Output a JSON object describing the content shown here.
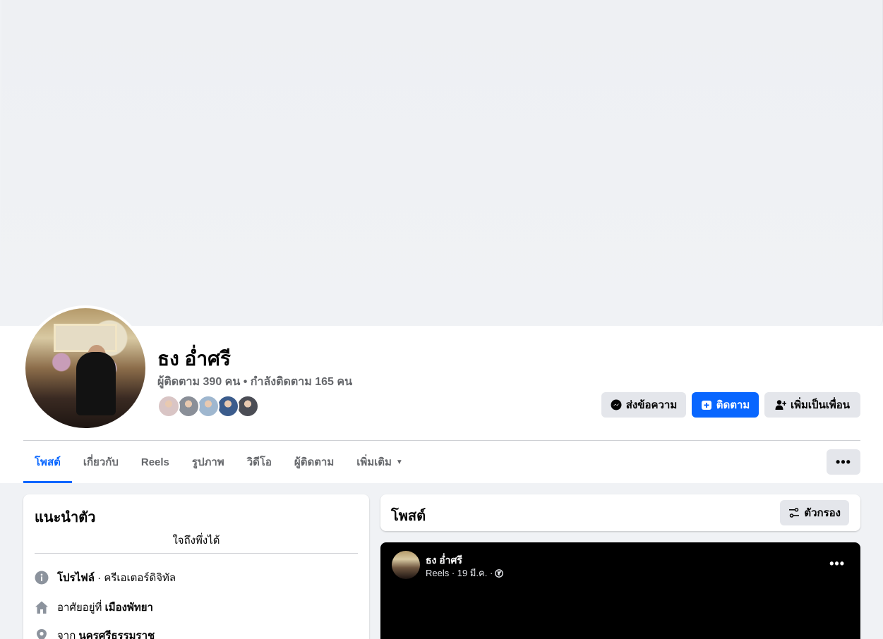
{
  "profile": {
    "name": "ธง อ่ำศรี",
    "stats": "ผู้ติดตาม 390 คน • กำลังติดตาม 165 คน",
    "friend_colors": [
      "#d9c5c5",
      "#8a8f98",
      "#9fb7cf",
      "#3b5c8c",
      "#4b4d55"
    ]
  },
  "actions": {
    "message": "ส่งข้อความ",
    "follow": "ติดตาม",
    "add_friend": "เพิ่มเป็นเพื่อน"
  },
  "tabs": [
    {
      "label": "โพสต์",
      "active": true
    },
    {
      "label": "เกี่ยวกับ",
      "active": false
    },
    {
      "label": "Reels",
      "active": false
    },
    {
      "label": "รูปภาพ",
      "active": false
    },
    {
      "label": "วิดีโอ",
      "active": false
    },
    {
      "label": "ผู้ติดตาม",
      "active": false
    },
    {
      "label": "เพิ่มเติม",
      "active": false
    }
  ],
  "more_label": "•••",
  "intro": {
    "title": "แนะนำตัว",
    "bio": "ใจถึงพึ่งได้",
    "rows": [
      {
        "icon": "info-icon",
        "bold": "โปรไฟล์",
        "text": " · ครีเอเตอร์ดิจิทัล"
      },
      {
        "icon": "home-icon",
        "prefix": "อาศัยอยู่ที่ ",
        "bold": "เมืองพัทยา"
      },
      {
        "icon": "location-pin-icon",
        "prefix": "จาก ",
        "bold": "นครศรีธรรมราช"
      }
    ]
  },
  "posts": {
    "title": "โพสต์",
    "filter": "ตัวกรอง"
  },
  "reel_post": {
    "author": "ธง อ่ำศรี",
    "meta": "Reels · 19 มี.ค. ·",
    "menu": "•••"
  },
  "colors": {
    "accent": "#0866ff",
    "secondary_text": "#65676b",
    "button_gray": "#e4e6eb"
  }
}
